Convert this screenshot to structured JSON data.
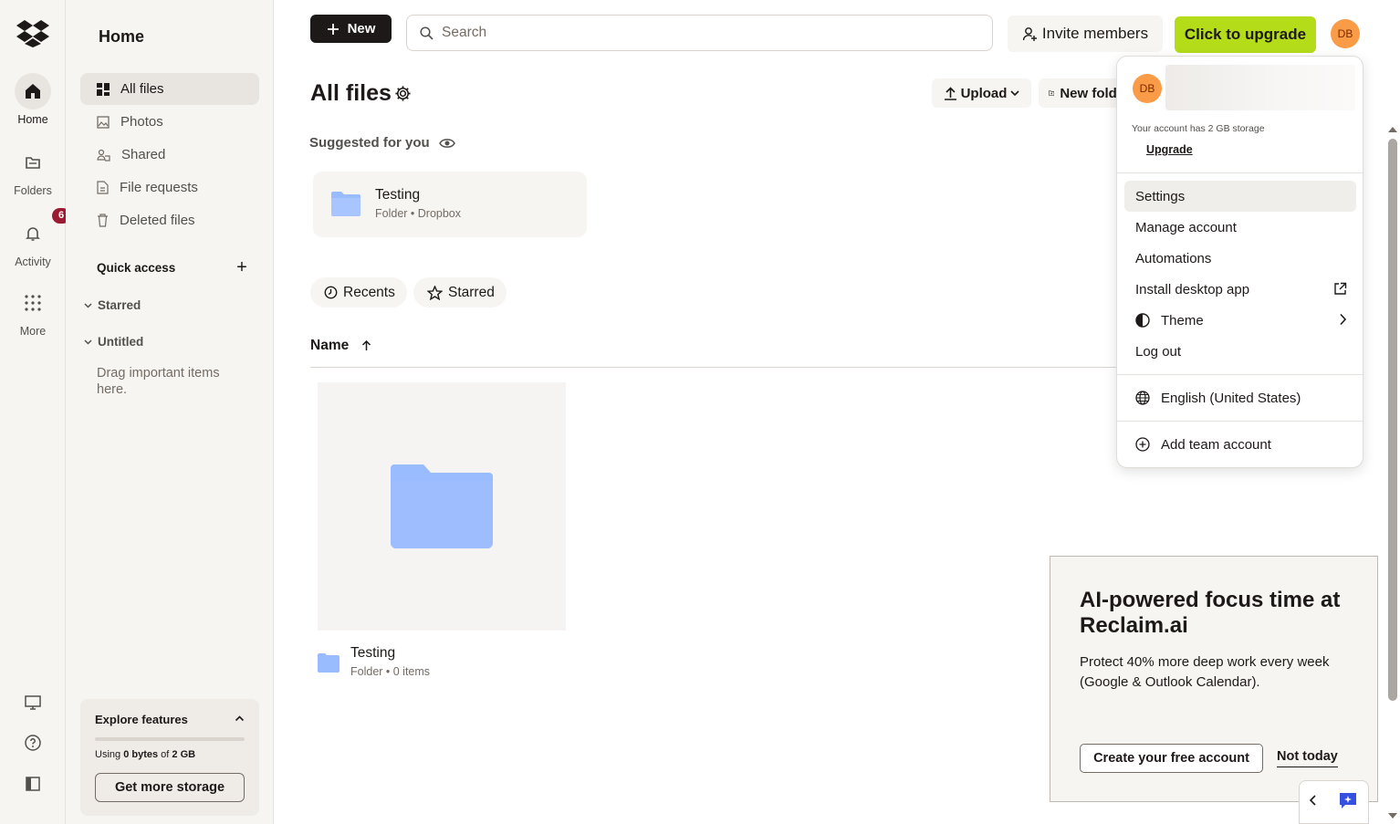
{
  "rail": {
    "items": [
      {
        "label": "Home",
        "icon": "home-icon"
      },
      {
        "label": "Folders",
        "icon": "folders-icon"
      },
      {
        "label": "Activity",
        "icon": "bell-icon",
        "badge": "6"
      },
      {
        "label": "More",
        "icon": "grid-icon"
      }
    ]
  },
  "sidebar": {
    "title": "Home",
    "nav": [
      {
        "label": "All files",
        "icon": "all-files-icon"
      },
      {
        "label": "Photos",
        "icon": "photos-icon"
      },
      {
        "label": "Shared",
        "icon": "shared-icon"
      },
      {
        "label": "File requests",
        "icon": "file-requests-icon"
      },
      {
        "label": "Deleted files",
        "icon": "trash-icon"
      }
    ],
    "quick_access": "Quick access",
    "starred": "Starred",
    "untitled": "Untitled",
    "drag_hint": "Drag important items here.",
    "explore": {
      "title": "Explore features",
      "usage_prefix": "Using ",
      "usage_used": "0 bytes",
      "usage_mid": " of ",
      "usage_total": "2 GB",
      "usage_fraction": 0.0,
      "button": "Get more storage"
    }
  },
  "topbar": {
    "new_label": "New",
    "search_placeholder": "Search",
    "invite_label": "Invite members",
    "upgrade_label": "Click to upgrade",
    "avatar_initials": "DB"
  },
  "main": {
    "title": "All files",
    "upload_label": "Upload",
    "new_folder_label": "New folder",
    "suggested_label": "Suggested for you",
    "suggested_card": {
      "name": "Testing",
      "meta": "Folder • Dropbox"
    },
    "filters": [
      "Recents",
      "Starred"
    ],
    "name_column": "Name",
    "files": [
      {
        "name": "Testing",
        "meta": "Folder • 0 items"
      }
    ]
  },
  "promo": {
    "title": "AI-powered focus time at Reclaim.ai",
    "body": "Protect 40% more deep work every week (Google & Outlook Calendar).",
    "cta": "Create your free account",
    "dismiss": "Not today"
  },
  "account_menu": {
    "initials": "DB",
    "storage_text": "Your account has 2 GB storage",
    "upgrade": "Upgrade",
    "items": [
      "Settings",
      "Manage account",
      "Automations",
      "Install desktop app",
      "Theme",
      "Log out"
    ],
    "language": "English (United States)",
    "add_team": "Add team account"
  },
  "colors": {
    "accent_green": "#b4dc19",
    "avatar": "#fa9b47",
    "folder_blue": "#99bbff",
    "badge_red": "#9b1b33"
  }
}
